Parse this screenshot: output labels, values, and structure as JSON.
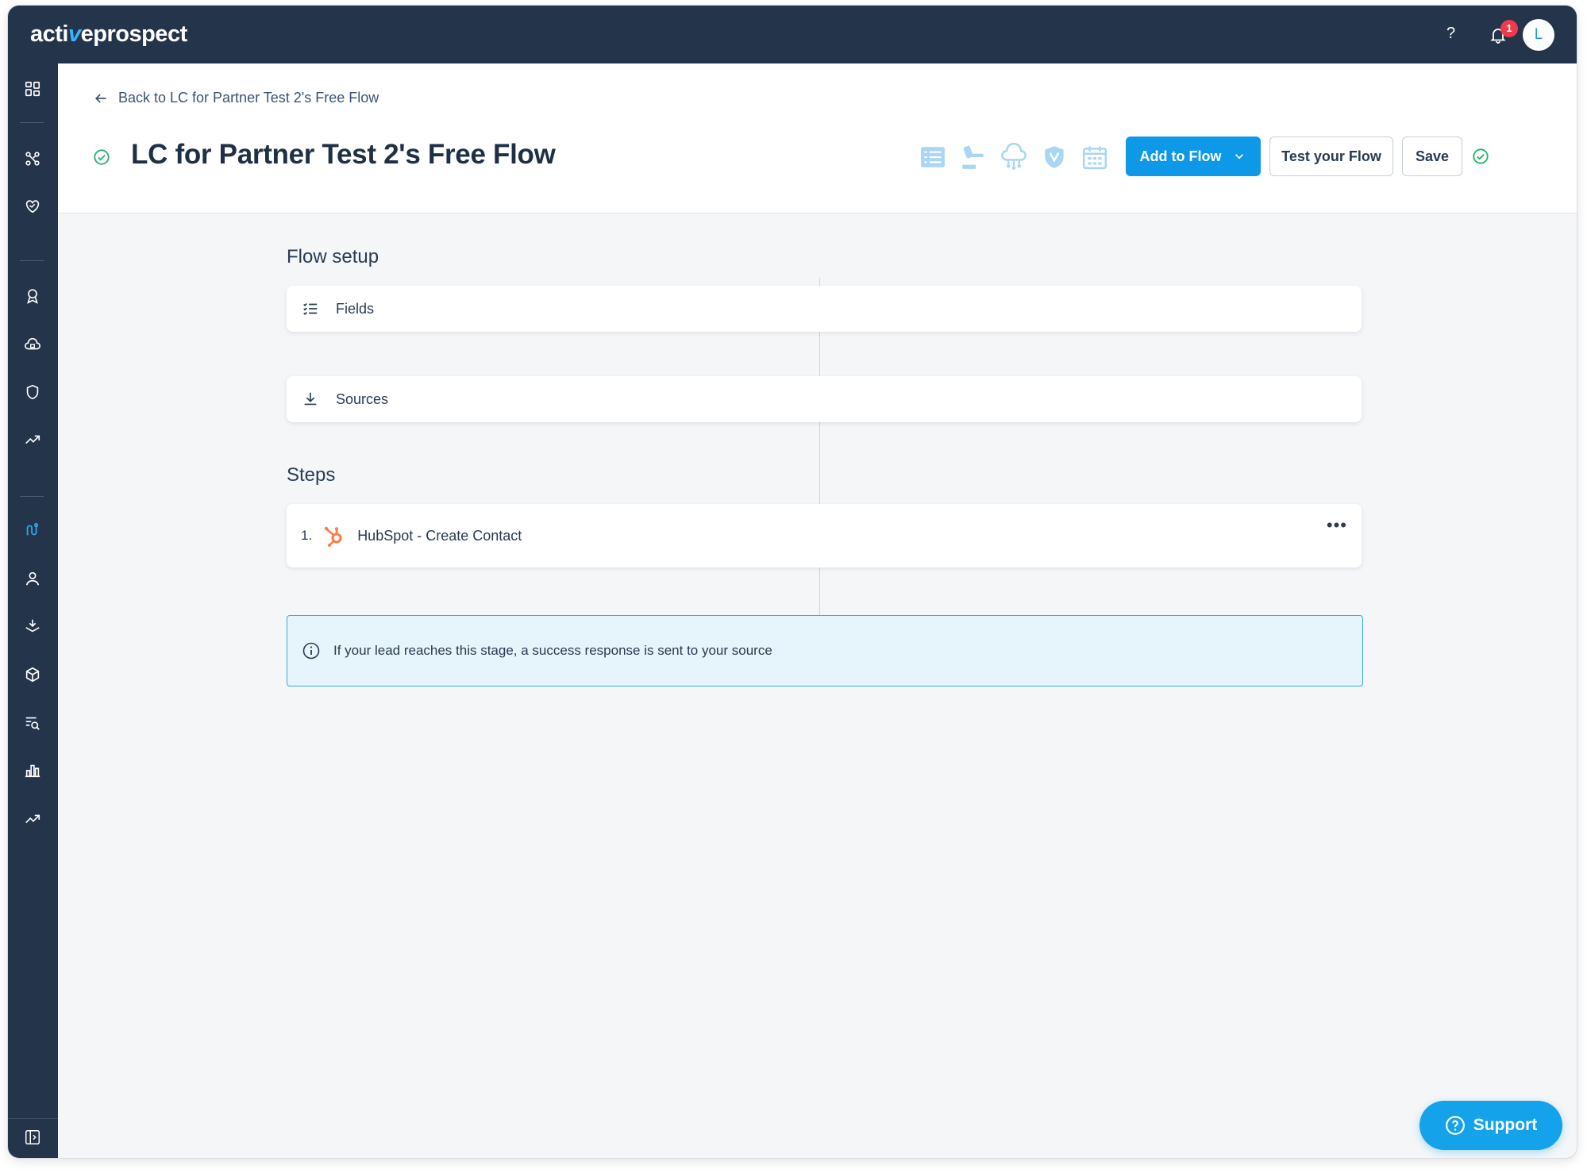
{
  "app": {
    "logo_prefix": "acti",
    "logo_v": "v",
    "logo_suffix": "eprospect",
    "help_label": "?",
    "notification_count": "1",
    "avatar_initial": "L"
  },
  "sidebar": {
    "items": [
      {
        "icon": "dashboard-icon"
      },
      {
        "icon": "flows-icon"
      },
      {
        "icon": "heart-handshake-icon"
      },
      {
        "icon": "award-icon"
      },
      {
        "icon": "cloud-lock-icon"
      },
      {
        "icon": "shield-icon"
      },
      {
        "icon": "trend-icon"
      },
      {
        "icon": "flow-builder-icon",
        "active": true
      },
      {
        "icon": "user-icon"
      },
      {
        "icon": "stack-download-icon"
      },
      {
        "icon": "box-icon"
      },
      {
        "icon": "search-list-icon"
      },
      {
        "icon": "bar-chart-icon"
      },
      {
        "icon": "trend-up-icon"
      }
    ],
    "collapse_icon": "sidebar-toggle-icon"
  },
  "header": {
    "back_label": "Back to LC for Partner Test 2's Free Flow",
    "title": "LC for Partner Test 2's Free Flow",
    "add_button": "Add to Flow",
    "test_button": "Test your Flow",
    "save_button": "Save"
  },
  "flow_setup": {
    "title": "Flow setup",
    "fields_label": "Fields",
    "sources_label": "Sources"
  },
  "steps": {
    "title": "Steps",
    "items": [
      {
        "number": "1.",
        "label": "HubSpot - Create Contact"
      }
    ]
  },
  "info": {
    "text": "If your lead reaches this stage, a success response is sent to your source"
  },
  "support": {
    "label": "Support"
  },
  "colors": {
    "nav": "#23344b",
    "primary": "#0d98e8",
    "success": "#27b36a",
    "hubspot": "#ff7a45",
    "badge": "#ef3a4c"
  }
}
